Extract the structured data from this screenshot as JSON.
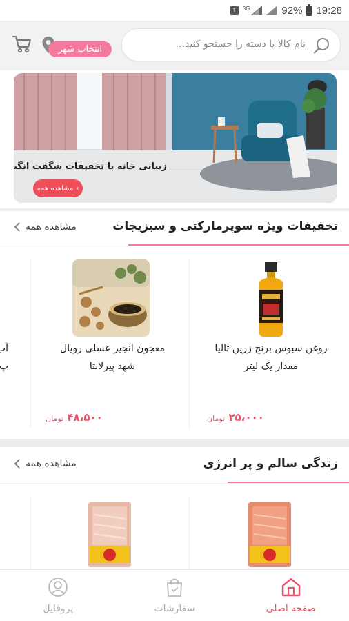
{
  "status_bar": {
    "sim": "1",
    "net": "3G",
    "battery": "92%",
    "time": "19:28"
  },
  "header": {
    "city_button": "انتخاب شهر",
    "search_placeholder": "نام کالا یا دسته را جستجو کنید..."
  },
  "banner": {
    "title": "زیبایی خانه با تخفیفات شگفت انگیز",
    "button": "مشاهده همه"
  },
  "sections": [
    {
      "title": "تخفیفات ویژه سوپرمارکتی و سبزیجات",
      "see_all": "مشاهده همه",
      "products": [
        {
          "name_line1": "روغن سبوس برنج زرین تالیا",
          "name_line2": "مقدار یک لیتر",
          "price": "۲۵،۰۰۰",
          "currency": "تومان"
        },
        {
          "name_line1": "معجون انجیر عسلی رویال",
          "name_line2": "شهد پیرلانتا",
          "price": "۴۸،۵۰۰",
          "currency": "تومان"
        },
        {
          "name_line1": "آب",
          "name_line2": "پ"
        }
      ]
    },
    {
      "title": "زندگی سالم و پر انرژی",
      "see_all": "مشاهده همه"
    }
  ],
  "bottom_nav": {
    "home": "صفحه اصلی",
    "orders": "سفارشات",
    "profile": "پروفایل"
  },
  "colors": {
    "accent": "#f37a9c",
    "price": "#ef4f66",
    "banner_wall": "#3a7fa0"
  }
}
